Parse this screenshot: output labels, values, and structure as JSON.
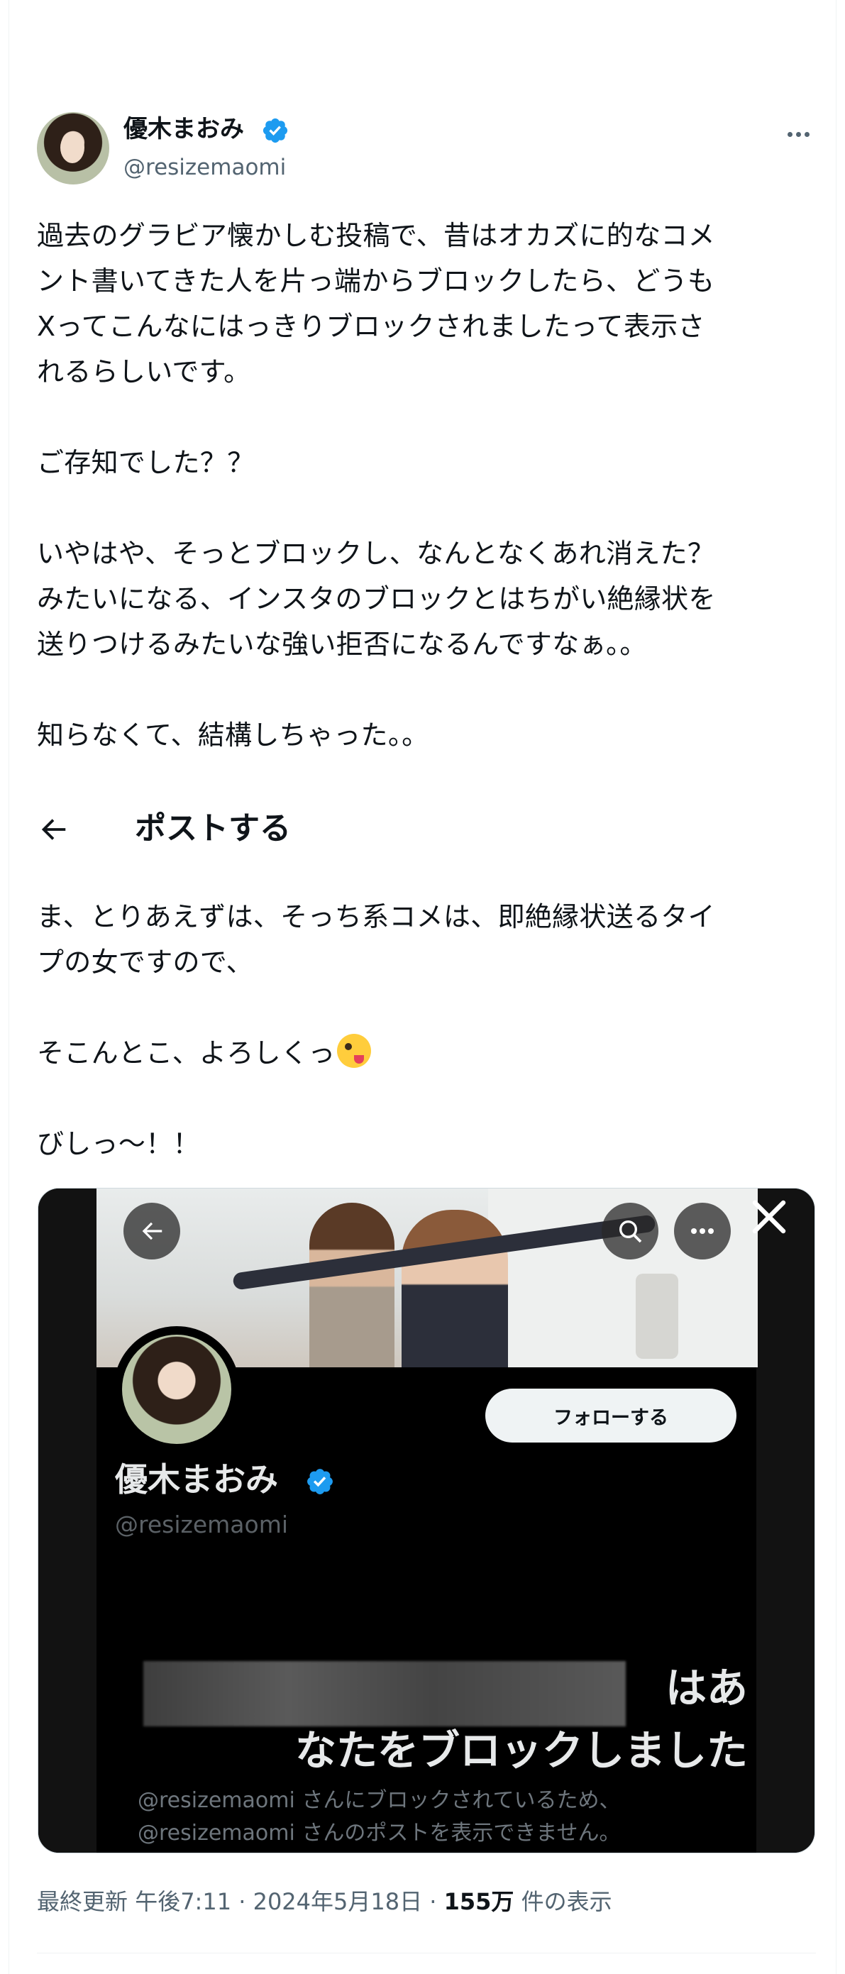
{
  "author": {
    "name": "優木まおみ",
    "handle": "@resizemaomi",
    "verified": true,
    "verified_color": "#1d9bf0"
  },
  "tweet": {
    "paragraphs": [
      "過去のグラビア懐かしむ投稿で、昔はオカズに的なコメ\nント書いてきた人を片っ端からブロックしたら、どうも\nXってこんなにはっきりブロックされましたって表示さ\nれるらしいです。",
      "ご存知でした？？",
      "いやはや、そっとブロックし、なんとなくあれ消えた？\nみたいになる、インスタのブロックとはちがい絶縁状を\n送りつけるみたいな強い拒否になるんですなぁ。。",
      "知らなくて、結構しちゃった。。"
    ],
    "embedded_header": "ポストする",
    "paragraphs_after": [
      "ま、とりあえずは、そっち系コメは、即絶縁状送るタイ\nプの女ですので、",
      "そこんとこ、よろしくっ",
      "びしっ～！！"
    ],
    "emoji_name": "zany-face-emoji"
  },
  "screenshot": {
    "follow_label": "フォローする",
    "name": "優木まおみ",
    "handle": "@resizemaomi",
    "block_title_visible": "はあ\nなたをブロックしました",
    "block_desc": "@resizemaomi さんにブロックされているため、\n@resizemaomi さんのポストを表示できません。",
    "icons": [
      "back-arrow-icon",
      "search-icon",
      "more-icon",
      "close-icon"
    ]
  },
  "meta": {
    "prefix": "最終更新",
    "time": "午後7:11",
    "sep": "·",
    "date": "2024年5月18日",
    "views": "155万",
    "views_suffix": "件の表示"
  }
}
